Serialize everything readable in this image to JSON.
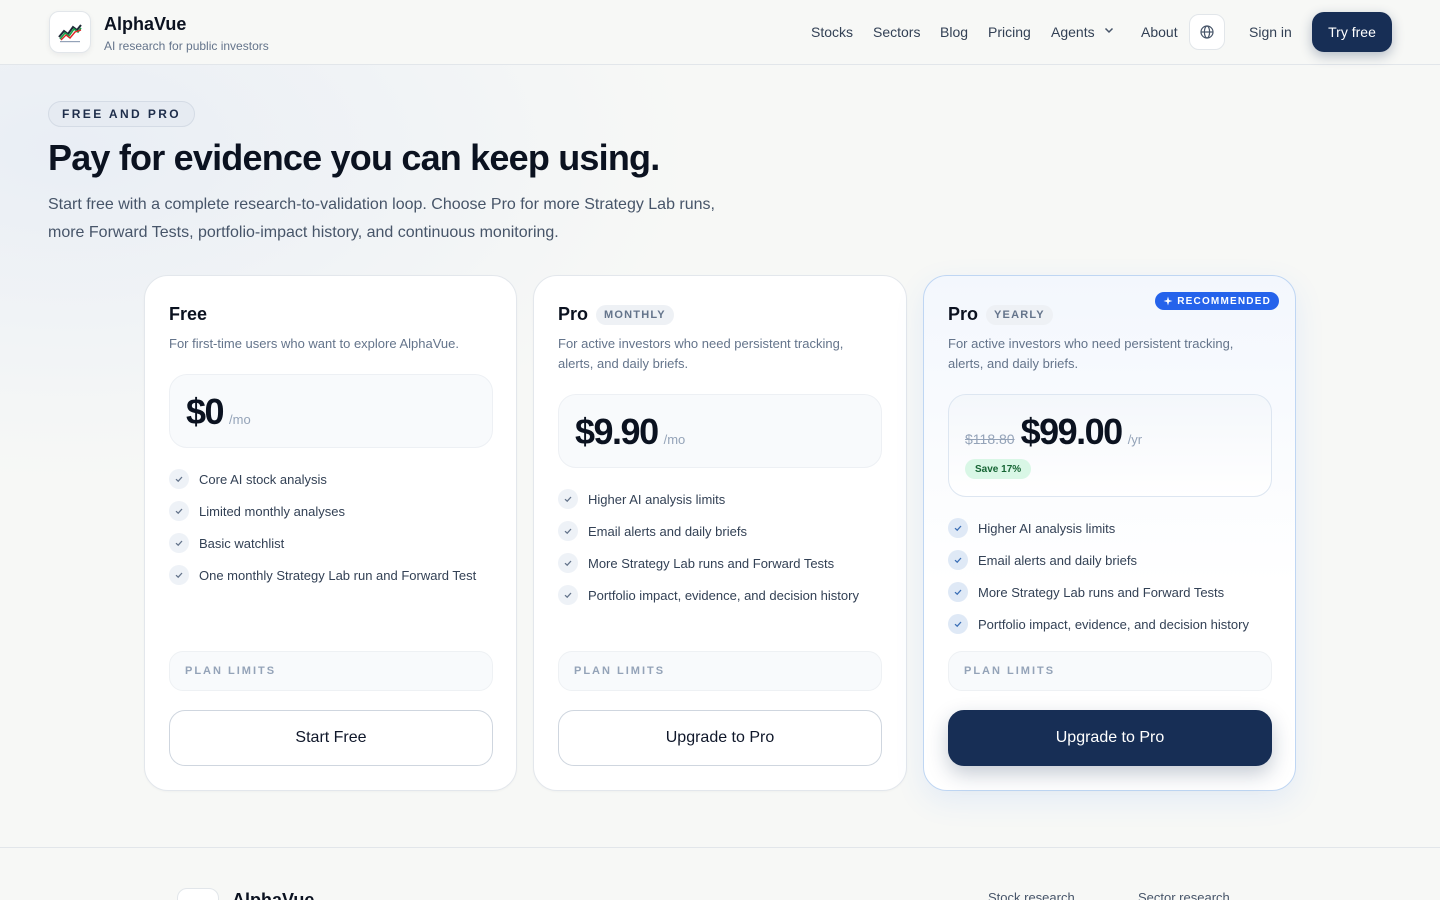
{
  "brand": {
    "name": "AlphaVue",
    "tagline": "AI research for public investors",
    "logo_icon": "chart-up-logo-icon"
  },
  "nav": {
    "items": [
      "Stocks",
      "Sectors",
      "Blog",
      "Pricing",
      "Agents",
      "About"
    ],
    "language_icon": "globe-icon",
    "sign_in": "Sign in",
    "try_free": "Try free"
  },
  "hero": {
    "eyebrow": "FREE AND PRO",
    "title": "Pay for evidence you can keep using.",
    "subtitle": "Start free with a complete research-to-validation loop. Choose Pro for more Strategy Lab runs, more Forward Tests, portfolio-impact history, and continuous monitoring."
  },
  "plans": [
    {
      "name": "Free",
      "badge": "",
      "description": "For first-time users who want to explore AlphaVue.",
      "price": "$0",
      "old_price": "",
      "unit": "/mo",
      "save": "",
      "features": [
        "Core AI stock analysis",
        "Limited monthly analyses",
        "Basic watchlist",
        "One monthly Strategy Lab run and Forward Test"
      ],
      "limits_label": "PLAN LIMITS",
      "cta": "Start Free"
    },
    {
      "name": "Pro",
      "badge": "MONTHLY",
      "description": "For active investors who need persistent tracking, alerts, and daily briefs.",
      "price": "$9.90",
      "old_price": "",
      "unit": "/mo",
      "save": "",
      "features": [
        "Higher AI analysis limits",
        "Email alerts and daily briefs",
        "More Strategy Lab runs and Forward Tests",
        "Portfolio impact, evidence, and decision history"
      ],
      "limits_label": "PLAN LIMITS",
      "cta": "Upgrade to Pro"
    },
    {
      "name": "Pro",
      "badge": "YEARLY",
      "recommended": "RECOMMENDED",
      "description": "For active investors who need persistent tracking, alerts, and daily briefs.",
      "price": "$99.00",
      "old_price": "$118.80",
      "unit": "/yr",
      "save": "Save 17%",
      "features": [
        "Higher AI analysis limits",
        "Email alerts and daily briefs",
        "More Strategy Lab runs and Forward Tests",
        "Portfolio impact, evidence, and decision history"
      ],
      "limits_label": "PLAN LIMITS",
      "cta": "Upgrade to Pro"
    }
  ],
  "footer": {
    "brand": "AlphaVue",
    "links": [
      "Stock research",
      "Sector research"
    ]
  },
  "colors": {
    "primary": "#172e55",
    "accent": "#2563eb",
    "save_bg": "#d9f7e6",
    "save_text": "#166534",
    "background": "#f7f8f6"
  }
}
